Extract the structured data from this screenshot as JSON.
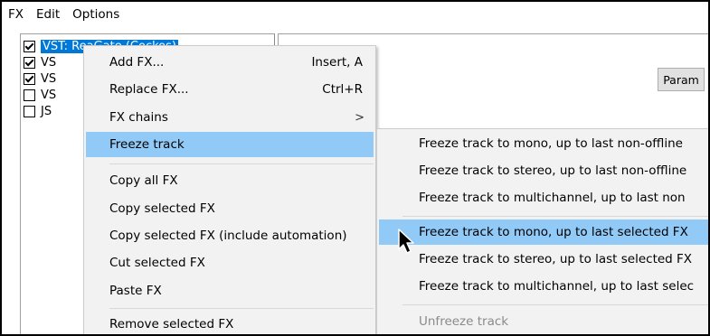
{
  "menubar": {
    "items": [
      "FX",
      "Edit",
      "Options"
    ]
  },
  "fx_list": [
    {
      "name": "VST: ReaGate (Cockos)",
      "checked": true,
      "selected": true
    },
    {
      "name": "VS",
      "checked": true,
      "selected": false
    },
    {
      "name": "VS",
      "checked": true,
      "selected": false
    },
    {
      "name": "VS",
      "checked": false,
      "selected": false
    },
    {
      "name": "JS",
      "checked": false,
      "selected": false
    }
  ],
  "right_panel": {
    "param_label": "Param"
  },
  "context_menu": {
    "items": [
      {
        "label": "Add FX...",
        "shortcut": "Insert, A"
      },
      {
        "label": "Replace FX...",
        "shortcut": "Ctrl+R"
      },
      {
        "label": "FX chains",
        "submenu_mark": ">"
      },
      {
        "label": "Freeze track"
      },
      {
        "label": "Copy all FX"
      },
      {
        "label": "Copy selected FX"
      },
      {
        "label": "Copy selected FX (include automation)"
      },
      {
        "label": "Cut selected FX"
      },
      {
        "label": "Paste FX"
      },
      {
        "label": "Remove selected FX"
      }
    ]
  },
  "freeze_submenu": {
    "items": [
      {
        "label": "Freeze track to mono, up to last non-offline"
      },
      {
        "label": "Freeze track to stereo, up to last non-offline"
      },
      {
        "label": "Freeze track to multichannel, up to last non"
      },
      {
        "label": "Freeze track to mono, up to last selected FX"
      },
      {
        "label": "Freeze track to stereo, up to last selected FX"
      },
      {
        "label": "Freeze track to multichannel, up to last selec"
      },
      {
        "label": "Unfreeze track"
      }
    ]
  }
}
